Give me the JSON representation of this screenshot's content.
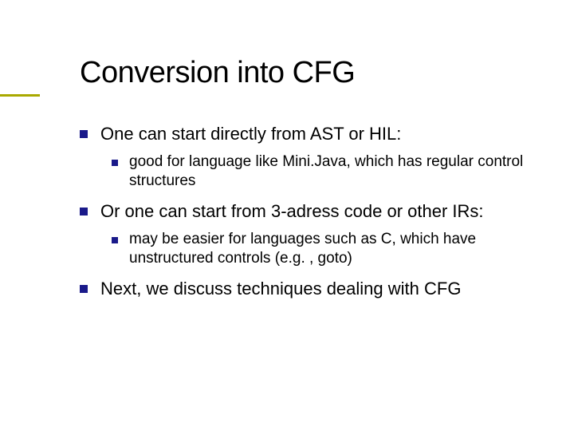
{
  "slide": {
    "title": "Conversion into CFG",
    "bullets": [
      {
        "text": "One can start directly from AST or HIL:",
        "children": [
          {
            "text": "good for language like Mini.Java, which has regular control structures"
          }
        ]
      },
      {
        "text": "Or one can start from 3-adress code or other IRs:",
        "children": [
          {
            "text": "may be easier for languages such as C, which have unstructured controls (e.g. , goto)"
          }
        ]
      },
      {
        "text": "Next, we discuss techniques dealing with CFG",
        "children": []
      }
    ]
  }
}
